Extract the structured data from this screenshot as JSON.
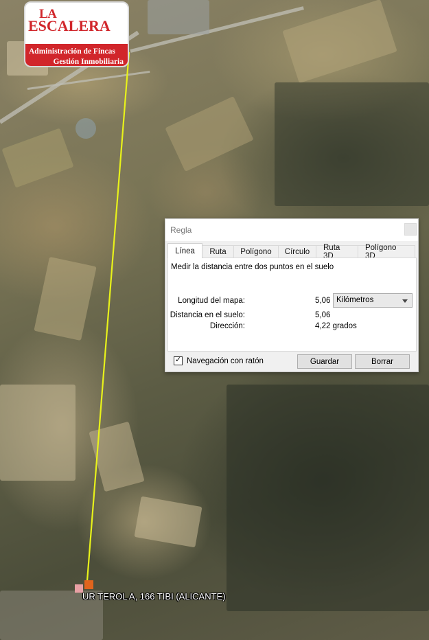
{
  "logo": {
    "line1": "LA",
    "line2": "ESCALERA",
    "tagline1": "Administración de Fincas",
    "tagline2": "Gestión Inmobiliaria"
  },
  "placemark": {
    "label": "UR TEROL A, 166  TIBI (ALICANTE)"
  },
  "ruler": {
    "title": "Regla",
    "tabs": [
      {
        "label": "Línea",
        "active": true
      },
      {
        "label": "Ruta",
        "active": false
      },
      {
        "label": "Polígono",
        "active": false
      },
      {
        "label": "Círculo",
        "active": false
      },
      {
        "label": "Ruta 3D",
        "active": false
      },
      {
        "label": "Polígono 3D",
        "active": false
      }
    ],
    "description": "Medir la distancia entre dos puntos en el suelo",
    "map_length_label": "Longitud del mapa:",
    "map_length_value": "5,06",
    "unit_selected": "Kilómetros",
    "ground_distance_label": "Distancia en el suelo:",
    "ground_distance_value": "5,06",
    "heading_label": "Dirección:",
    "heading_value": "4,22 grados",
    "mouse_nav_label": "Navegación con ratón",
    "mouse_nav_checked": true,
    "save_label": "Guardar",
    "clear_label": "Borrar"
  },
  "measure_line_color": "#e8f21a"
}
